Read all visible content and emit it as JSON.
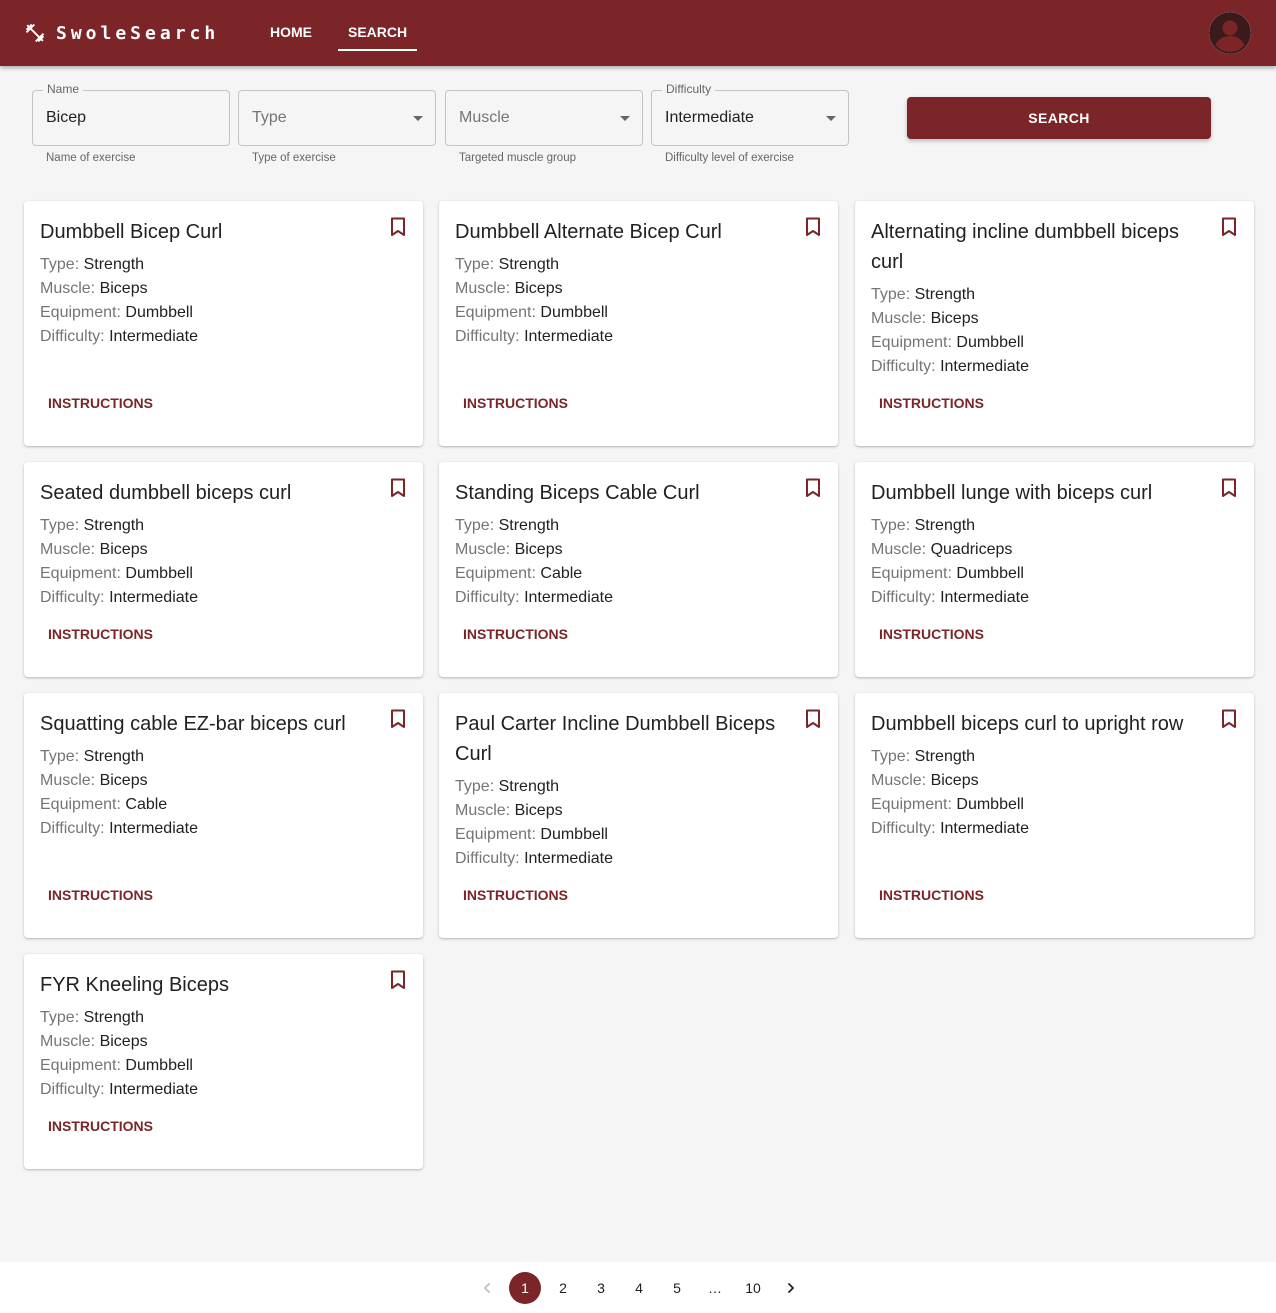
{
  "app": {
    "title": "SwoleSearch",
    "brand_color": "#7b2529",
    "nav": {
      "home": "HOME",
      "search": "SEARCH"
    },
    "active_nav": "search"
  },
  "filters": {
    "name": {
      "label": "Name",
      "value": "Bicep",
      "helper": "Name of exercise"
    },
    "type": {
      "placeholder": "Type",
      "helper": "Type of exercise"
    },
    "muscle": {
      "placeholder": "Muscle",
      "helper": "Targeted muscle group"
    },
    "difficulty": {
      "label": "Difficulty",
      "value": "Intermediate",
      "helper": "Difficulty level of exercise"
    },
    "search_button": "SEARCH"
  },
  "labels": {
    "type": "Type:",
    "muscle": "Muscle:",
    "equipment": "Equipment:",
    "difficulty": "Difficulty:",
    "instructions": "INSTRUCTIONS"
  },
  "results": [
    {
      "name": "Dumbbell Bicep Curl",
      "type": "Strength",
      "muscle": "Biceps",
      "equipment": "Dumbbell",
      "difficulty": "Intermediate"
    },
    {
      "name": "Dumbbell Alternate Bicep Curl",
      "type": "Strength",
      "muscle": "Biceps",
      "equipment": "Dumbbell",
      "difficulty": "Intermediate"
    },
    {
      "name": "Alternating incline dumbbell biceps curl",
      "type": "Strength",
      "muscle": "Biceps",
      "equipment": "Dumbbell",
      "difficulty": "Intermediate"
    },
    {
      "name": "Seated dumbbell biceps curl",
      "type": "Strength",
      "muscle": "Biceps",
      "equipment": "Dumbbell",
      "difficulty": "Intermediate"
    },
    {
      "name": "Standing Biceps Cable Curl",
      "type": "Strength",
      "muscle": "Biceps",
      "equipment": "Cable",
      "difficulty": "Intermediate"
    },
    {
      "name": "Dumbbell lunge with biceps curl",
      "type": "Strength",
      "muscle": "Quadriceps",
      "equipment": "Dumbbell",
      "difficulty": "Intermediate"
    },
    {
      "name": "Squatting cable EZ-bar biceps curl",
      "type": "Strength",
      "muscle": "Biceps",
      "equipment": "Cable",
      "difficulty": "Intermediate"
    },
    {
      "name": "Paul Carter Incline Dumbbell Biceps Curl",
      "type": "Strength",
      "muscle": "Biceps",
      "equipment": "Dumbbell",
      "difficulty": "Intermediate"
    },
    {
      "name": "Dumbbell biceps curl to upright row",
      "type": "Strength",
      "muscle": "Biceps",
      "equipment": "Dumbbell",
      "difficulty": "Intermediate"
    },
    {
      "name": "FYR Kneeling Biceps",
      "type": "Strength",
      "muscle": "Biceps",
      "equipment": "Dumbbell",
      "difficulty": "Intermediate"
    }
  ],
  "pagination": {
    "pages": [
      "1",
      "2",
      "3",
      "4",
      "5",
      "…",
      "10"
    ],
    "current": "1"
  }
}
